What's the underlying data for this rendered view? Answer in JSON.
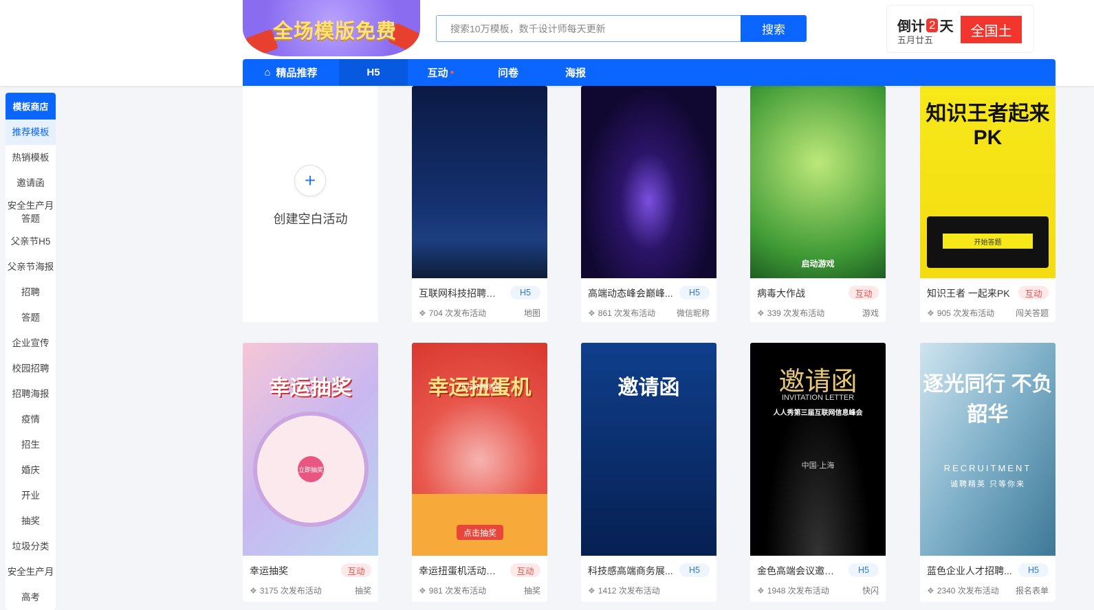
{
  "banner": {
    "text": "全场模版免费"
  },
  "search": {
    "placeholder": "搜索10万模板，数千设计师每天更新",
    "button": "搜索"
  },
  "countdown": {
    "prefix": "倒计",
    "days": "2",
    "suffix": "天",
    "date": "五月廿五",
    "button": "全国土"
  },
  "nav": [
    {
      "label": "精品推荐",
      "icon": "home-icon"
    },
    {
      "label": "H5"
    },
    {
      "label": "互动",
      "icon": "fire-icon"
    },
    {
      "label": "问卷"
    },
    {
      "label": "海报"
    }
  ],
  "sidebar": {
    "header": "模板商店",
    "items": [
      "推荐模板",
      "热销模板",
      "邀请函",
      "安全生产月答题",
      "父亲节H5",
      "父亲节海报",
      "招聘",
      "答题",
      "企业宣传",
      "校园招聘",
      "招聘海报",
      "疫情",
      "招生",
      "婚庆",
      "开业",
      "抽奖",
      "垃圾分类",
      "安全生产月",
      "高考"
    ]
  },
  "create": {
    "label": "创建空白活动"
  },
  "cards": [
    {
      "title": "互联网科技招聘模板",
      "tag": "H5",
      "count": "704 次发布活动",
      "category": "地图"
    },
    {
      "title": "高端动态峰会巅峰...",
      "tag": "H5",
      "count": "861 次发布活动",
      "category": "微信昵称"
    },
    {
      "title": "病毒大作战",
      "tag": "互动",
      "count": "339 次发布活动",
      "category": "游戏",
      "poster": "启动游戏"
    },
    {
      "title": "知识王者 一起来PK",
      "tag": "互动",
      "count": "905 次发布活动",
      "category": "闯关答题",
      "poster": "知识王者起来PK",
      "poster_btn": "开始答题"
    },
    {
      "title": "幸运抽奖",
      "tag": "互动",
      "count": "3175 次发布活动",
      "category": "抽奖",
      "poster": "幸运抽奖",
      "poster_center": "立即抽奖"
    },
    {
      "title": "幸运扭蛋机活动抽奖",
      "tag": "互动",
      "count": "981 次发布活动",
      "category": "抽奖",
      "poster": "幸运扭蛋机",
      "poster_sub": "千万好等你来",
      "poster_btn": "点击抽奖"
    },
    {
      "title": "科技感高端商务展...",
      "tag": "H5",
      "count": "1412 次发布活动",
      "category": "",
      "poster": "邀请函"
    },
    {
      "title": "金色高端会议邀请函",
      "tag": "H5",
      "count": "1948 次发布活动",
      "category": "快闪",
      "poster": "邀请函",
      "poster_sub": "INVITATION LETTER",
      "poster_line": "人人秀第三届互联网信息峰会",
      "poster_loc": "中国·上海"
    },
    {
      "title": "蓝色企业人才招聘...",
      "tag": "H5",
      "count": "2340 次发布活动",
      "category": "报名表单",
      "poster": "逐光同行 不负韶华",
      "poster_sub": "RECRUITMENT",
      "poster_line": "诚聘精英 只等你来"
    }
  ],
  "colors": {
    "primary": "#0a66ff",
    "red": "#f2352d"
  }
}
